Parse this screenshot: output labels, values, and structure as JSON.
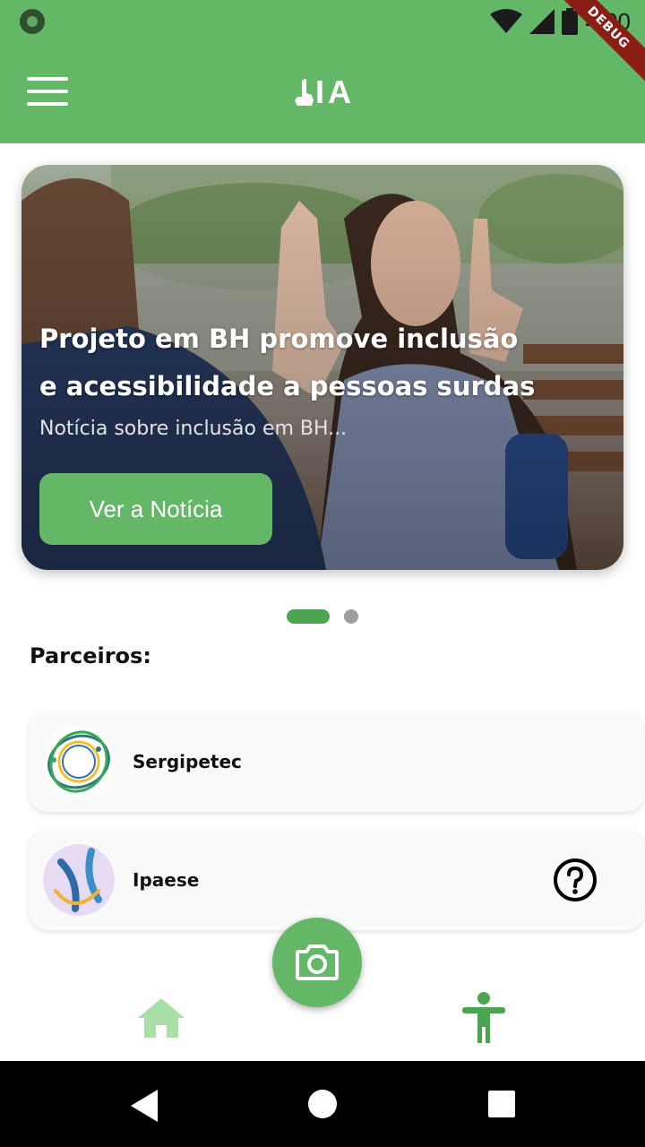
{
  "status_bar": {
    "time": "4:00",
    "debug_label": "DEBUG"
  },
  "app_bar": {
    "logo_text": "IA",
    "menu_icon": "hamburger-menu-icon"
  },
  "carousel": {
    "title": "Projeto em BH promove inclusão e acessibilidade a pessoas surdas",
    "subtitle": "Notícia sobre inclusão em BH...",
    "button_label": "Ver a Notícia",
    "active_index": 0,
    "page_count": 2
  },
  "partners": {
    "section_title": "Parceiros:",
    "items": [
      {
        "name": "Sergipetec",
        "logo_icon": "sergipetec-logo"
      },
      {
        "name": "Ipaese",
        "logo_icon": "ipaese-logo"
      }
    ]
  },
  "actions": {
    "help_icon": "question-circle-icon",
    "camera_icon": "camera-icon"
  },
  "bottom_nav": {
    "items": [
      {
        "icon": "home-icon"
      },
      {
        "icon": "accessibility-icon"
      }
    ]
  },
  "colors": {
    "primary": "#63b767",
    "primary_dark": "#4aa54e",
    "indicator_inactive": "#9e9e9e",
    "nav_home_inactive": "#a8e0a8"
  }
}
